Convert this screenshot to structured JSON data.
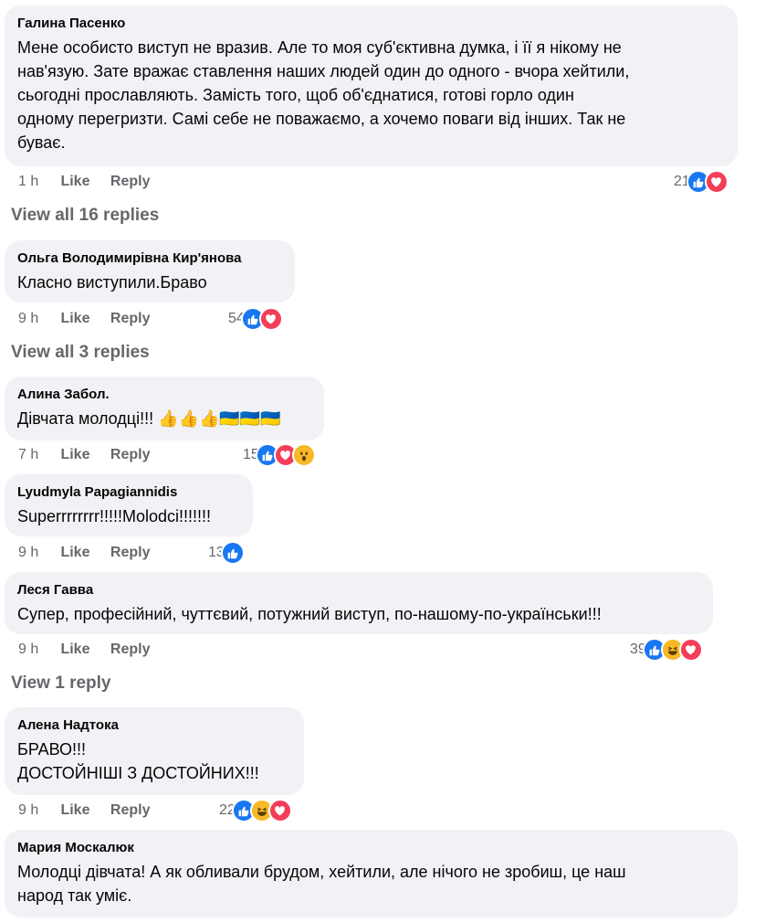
{
  "actions": {
    "like": "Like",
    "reply": "Reply"
  },
  "comments": [
    {
      "author": "Галина Пасенко",
      "text": "Мене особисто виступ не вразив. Але то моя суб'єктивна думка, і її я нікому не\nнав'язую. Зате вражає ставлення наших людей один до одного - вчора хейтили,\nсьогодні прославляють. Замість того, щоб об'єднатися, готові горло один\nодному перегризти. Самі себе не поважаємо, а хочемо поваги від інших. Так не\nбуває.",
      "time": "1 h",
      "count": "21",
      "reactions": [
        "like",
        "love"
      ]
    },
    {
      "author": "Ольга Володимирівна Кир'янова",
      "text": "Класно виступили.Браво",
      "time": "9 h",
      "count": "54",
      "reactions": [
        "like",
        "love"
      ]
    },
    {
      "author": "Алина Забол.",
      "text": "Дівчата молодці!!! 👍👍👍🇺🇦🇺🇦🇺🇦",
      "time": "7 h",
      "count": "15",
      "reactions": [
        "like",
        "love",
        "wow"
      ]
    },
    {
      "author": "Lyudmyla Papagiannidis",
      "text": "Superrrrrrrr!!!!!Molodci!!!!!!!",
      "time": "9 h",
      "count": "13",
      "reactions": [
        "like"
      ]
    },
    {
      "author": "Леся Гавва",
      "text": "Супер, професійний, чуттєвий, потужний виступ, по-нашому-по-українськи!!!",
      "time": "9 h",
      "count": "39",
      "reactions": [
        "like",
        "haha",
        "love"
      ]
    },
    {
      "author": "Алена Надтока",
      "text": "БРАВО!!!\nДОСТОЙНІШІ З ДОСТОЙНИХ!!!",
      "time": "9 h",
      "count": "22",
      "reactions": [
        "like",
        "haha",
        "love"
      ]
    },
    {
      "author": "Мария Москалюк",
      "text": "Молодці дівчата! А як обливали брудом, хейтили, але нічого не зробиш, це наш\nнарод так уміє."
    }
  ],
  "view_replies": [
    "View all 16 replies",
    "View all 3 replies",
    "View 1 reply"
  ],
  "colors": {
    "like": "#1877f2",
    "love": "#f33e58",
    "haha": "#f7b928",
    "bubble": "#f0f2f5",
    "meta": "#65676b"
  },
  "icons": {
    "like": "thumbs-up-icon",
    "love": "heart-icon",
    "haha": "laughing-face-icon",
    "wow": "wow-face-icon"
  }
}
